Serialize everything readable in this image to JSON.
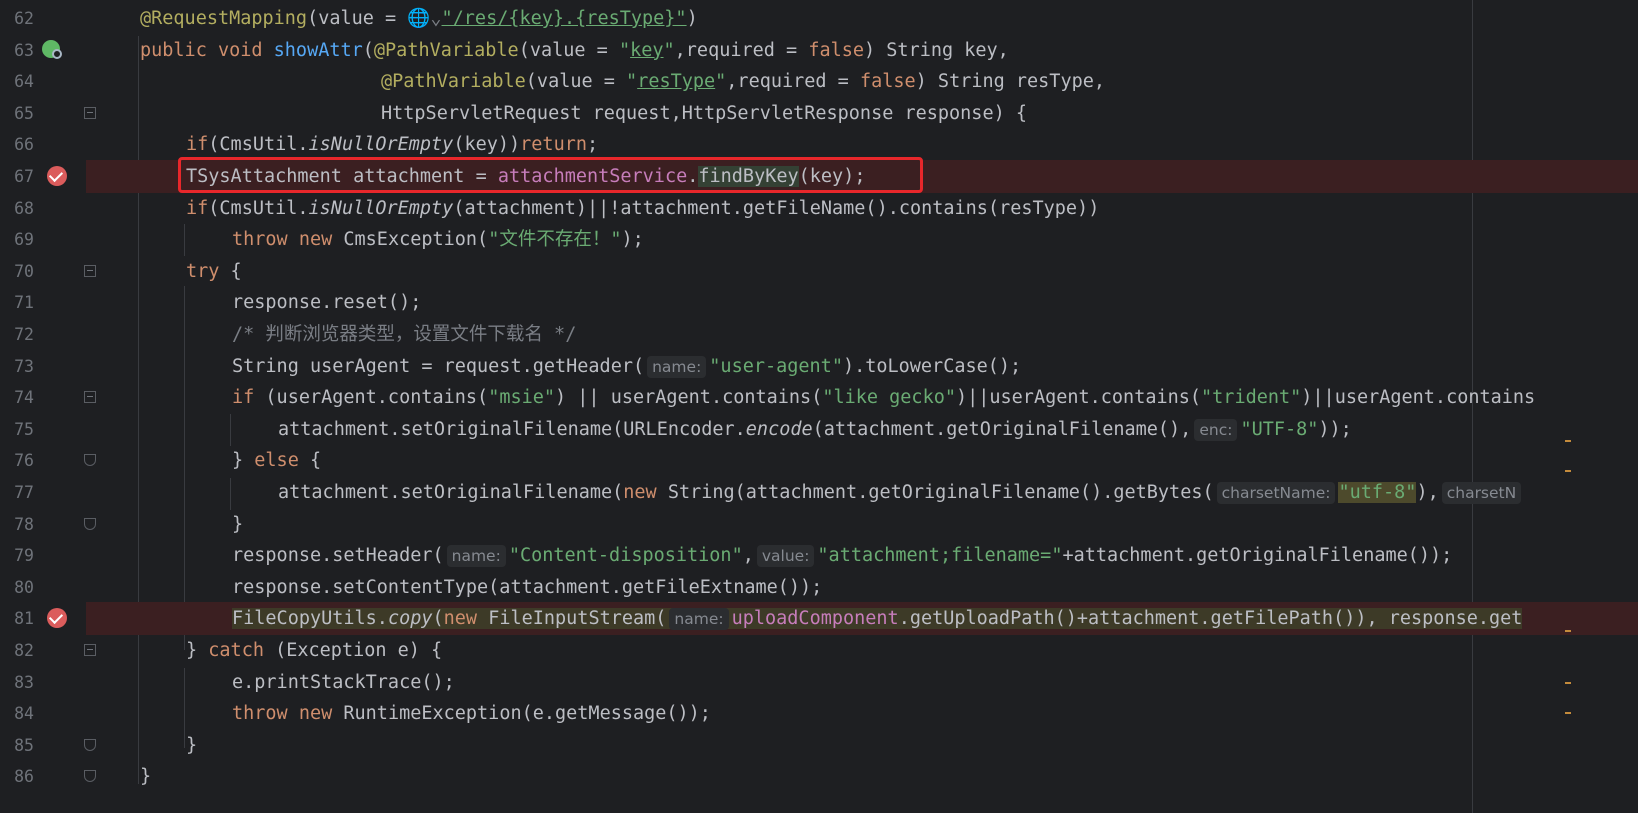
{
  "editor": {
    "lines": [
      {
        "num": "62"
      },
      {
        "num": "63"
      },
      {
        "num": "64"
      },
      {
        "num": "65"
      },
      {
        "num": "66"
      },
      {
        "num": "67"
      },
      {
        "num": "68"
      },
      {
        "num": "69"
      },
      {
        "num": "70"
      },
      {
        "num": "71"
      },
      {
        "num": "72"
      },
      {
        "num": "73"
      },
      {
        "num": "74"
      },
      {
        "num": "75"
      },
      {
        "num": "76"
      },
      {
        "num": "77"
      },
      {
        "num": "78"
      },
      {
        "num": "79"
      },
      {
        "num": "80"
      },
      {
        "num": "81"
      },
      {
        "num": "82"
      },
      {
        "num": "83"
      },
      {
        "num": "84"
      },
      {
        "num": "85"
      },
      {
        "num": "86"
      }
    ],
    "code": {
      "l62_ann": "@RequestMapping",
      "l62_open": "(value = ",
      "l62_globe": "🌐⌄",
      "l62_str": "\"/res/{key}.{resType}\"",
      "l62_close": ")",
      "l63_kw": "public void ",
      "l63_fn": "showAttr",
      "l63_p": "(",
      "l63_ann": "@PathVariable",
      "l63_a": "(value = ",
      "l63_q1": "\"",
      "l63_key": "key",
      "l63_q2": "\"",
      "l63_b": ",required = ",
      "l63_false": "false",
      "l63_c": ") String key,",
      "l64_ann": "@PathVariable",
      "l64_a": "(value = ",
      "l64_q1": "\"",
      "l64_key": "resType",
      "l64_q2": "\"",
      "l64_b": ",required = ",
      "l64_false": "false",
      "l64_c": ") String resType,",
      "l65": "HttpServletRequest request,HttpServletResponse response) {",
      "l66_if": "if",
      "l66_a": "(CmsUtil.",
      "l66_static": "isNullOrEmpty",
      "l66_b": "(key))",
      "l66_ret": "return",
      "l66_c": ";",
      "l67_a": "TSysAttachment attachment = ",
      "l67_fld": "attachmentService",
      "l67_dot": ".",
      "l67_fn": "findByKey",
      "l67_b": "(key);",
      "l68_if": "if",
      "l68_a": "(CmsUtil.",
      "l68_static": "isNullOrEmpty",
      "l68_b": "(attachment)||!attachment.getFileName().contains(resType))",
      "l69_kw": "throw new ",
      "l69_a": "CmsException(",
      "l69_str": "\"文件不存在！\"",
      "l69_b": ");",
      "l70_kw": "try",
      "l70_a": " {",
      "l71": "response.reset();",
      "l72": "/* 判断浏览器类型，设置文件下载名 */",
      "l73_a": "String userAgent = request.getHeader(",
      "l73_hint": "name:",
      "l73_str": "\"user-agent\"",
      "l73_b": ").toLowerCase();",
      "l74_kw": "if",
      "l74_a": " (userAgent.contains(",
      "l74_s1": "\"msie\"",
      "l74_b": ") || userAgent.contains(",
      "l74_s2": "\"like gecko\"",
      "l74_c": ")||userAgent.contains(",
      "l74_s3": "\"trident\"",
      "l74_d": ")||userAgent.contains",
      "l75_a": "attachment.setOriginalFilename(URLEncoder.",
      "l75_static": "encode",
      "l75_b": "(attachment.getOriginalFilename(),",
      "l75_hint": "enc:",
      "l75_str": "\"UTF-8\"",
      "l75_c": "));",
      "l76_a": "} ",
      "l76_kw": "else",
      "l76_b": " {",
      "l77_a": "attachment.setOriginalFilename(",
      "l77_kw": "new ",
      "l77_b": "String(attachment.getOriginalFilename().getBytes(",
      "l77_hint": "charsetName:",
      "l77_str": "\"utf-8\"",
      "l77_c": "),",
      "l77_hint2": "charsetN",
      "l78": "}",
      "l79_a": "response.setHeader(",
      "l79_hint1": "name:",
      "l79_s1": "\"Content-disposition\"",
      "l79_b": ",",
      "l79_hint2": "value:",
      "l79_s2": "\"attachment;filename=\"",
      "l79_c": "+attachment.getOriginalFilename());",
      "l80": "response.setContentType(attachment.getFileExtname());",
      "l81_a": "FileCopyUtils.",
      "l81_static": "copy",
      "l81_b": "(",
      "l81_kw": "new ",
      "l81_c": "FileInputStream(",
      "l81_hint": "name:",
      "l81_fld": "uploadComponent",
      "l81_d": ".getUploadPath()+attachment.getFilePath()), response.get",
      "l82_a": "} ",
      "l82_kw": "catch",
      "l82_b": " (Exception e) {",
      "l83": "e.printStackTrace();",
      "l84_kw": "throw new ",
      "l84_a": "RuntimeException(e.getMessage());",
      "l85": "}",
      "l86": "}"
    }
  },
  "colors": {
    "background": "#1e1f22",
    "keyword": "#cf8e6d",
    "string": "#6aab73",
    "annotation": "#b3ae60",
    "method": "#56a8f5",
    "field": "#c77dbb",
    "highlight_box": "#e8272b",
    "breakpoint": "#db5c5c"
  },
  "icons": {
    "breakpoint_67": "breakpoint-check-icon",
    "breakpoint_81": "breakpoint-check-icon",
    "run_63": "web-endpoint-icon"
  }
}
